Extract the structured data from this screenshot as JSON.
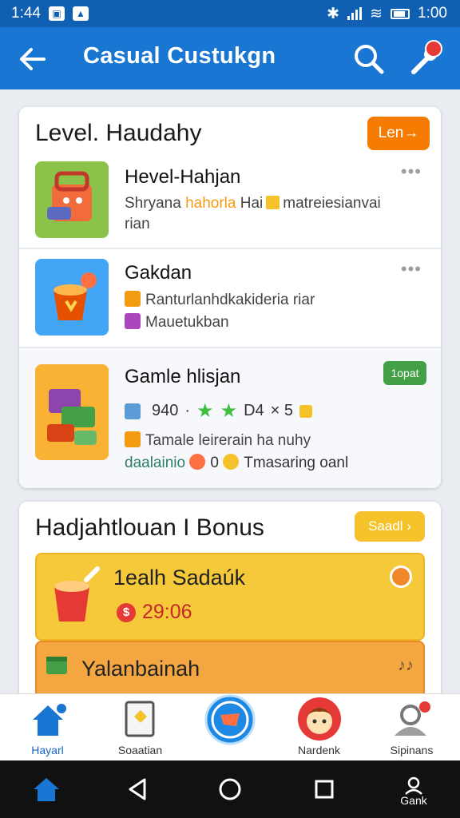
{
  "status_bar": {
    "time": "1:44",
    "clock_right": "1:00"
  },
  "app_bar": {
    "title": "Casual Custukgn"
  },
  "level_card": {
    "title": "Level. Haudahy",
    "action_label": "Len→",
    "rows": [
      {
        "name": "Hevel-Hahjan",
        "line1_a": "Shryana",
        "line1_b": "hahorla",
        "line1_c": "Hai",
        "line1_d": "matreiesianvai",
        "line2": "rian"
      },
      {
        "name": "Gakdan",
        "line1": "Ranturlanhdkakideria riar",
        "line2": "Mauetukban"
      },
      {
        "name": "Gamle hlisjan",
        "badge": "1opat",
        "stat_count": "940",
        "stat_sep": "·",
        "stat_code": "D4",
        "stat_mult": "× 5",
        "line1": "Tamale leirerain ha nuhy",
        "line2_a": "daalainio",
        "line2_b": "0",
        "line2_c": "Tmasaring oanl"
      }
    ]
  },
  "bonus_card": {
    "title": "Hadjahtlouan I Bonus",
    "action_label": "Saadl ›",
    "items": [
      {
        "title": "1ealh Sadaúk",
        "timer": "29:06"
      },
      {
        "title": "Yalanbainah"
      }
    ]
  },
  "bottom_nav": [
    {
      "label": "Hayarl"
    },
    {
      "label": "Soaatian"
    },
    {
      "label": ""
    },
    {
      "label": "Nardenk"
    },
    {
      "label": "Sipinans"
    }
  ],
  "system_nav": {
    "right_label": "Gank"
  },
  "colors": {
    "primary": "#1976d2",
    "accent_orange": "#f57c00",
    "accent_yellow": "#f6c22a",
    "accent_green": "#43a047"
  }
}
